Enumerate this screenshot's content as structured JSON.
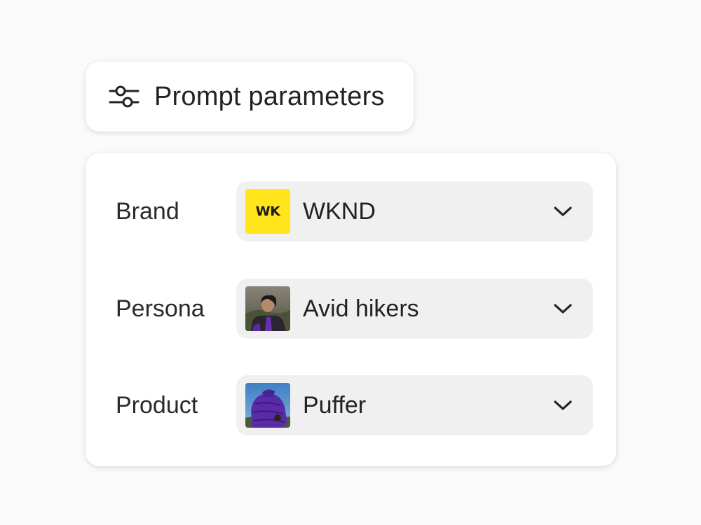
{
  "header": {
    "title": "Prompt parameters",
    "icon": "sliders-icon"
  },
  "parameters": [
    {
      "label": "Brand",
      "value": "WKND",
      "thumbnail": {
        "type": "logo",
        "text": "WK",
        "color": "#ffe51a"
      }
    },
    {
      "label": "Persona",
      "value": "Avid hikers",
      "thumbnail": {
        "type": "photo",
        "subject": "person-portrait"
      }
    },
    {
      "label": "Product",
      "value": "Puffer",
      "thumbnail": {
        "type": "photo",
        "subject": "purple-puffer-jacket"
      }
    }
  ],
  "colors": {
    "background": "#fafafa",
    "card": "#ffffff",
    "picker": "#f0f0f0",
    "text": "#222222",
    "brand_yellow": "#ffe51a"
  }
}
